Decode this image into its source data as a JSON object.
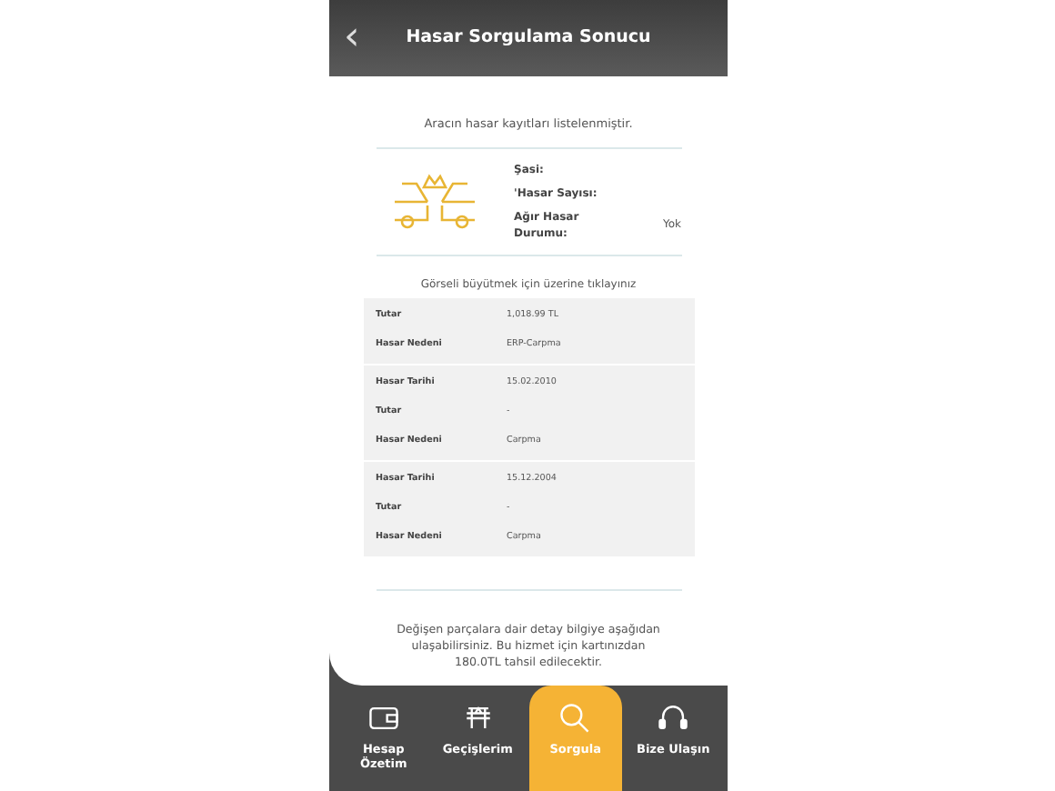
{
  "header": {
    "back": "‹",
    "title": "Hasar Sorgulama Sonucu"
  },
  "intro": "Aracın hasar kayıtları listelenmiştir.",
  "info": [
    {
      "label": "Şasi:"
    },
    {
      "label": "'Hasar Sayısı:"
    },
    {
      "label": "Ağır Hasar Durumu:",
      "value": "Yok"
    }
  ],
  "caption": "Görseli büyütmek için üzerine tıklayınız",
  "groups": [
    [
      {
        "label": "Tutar",
        "value": "1,018.99 TL"
      },
      {
        "label": "Hasar Nedeni",
        "value": "ERP-Carpma"
      }
    ],
    [
      {
        "label": "Hasar Tarihi",
        "value": "15.02.2010"
      },
      {
        "label": "Tutar",
        "value": "-"
      },
      {
        "label": "Hasar Nedeni",
        "value": "Carpma"
      }
    ],
    [
      {
        "label": "Hasar Tarihi",
        "value": "15.12.2004"
      },
      {
        "label": "Tutar",
        "value": "-"
      },
      {
        "label": "Hasar Nedeni",
        "value": "Carpma"
      }
    ]
  ],
  "note": "Değişen parçalara dair detay bilgiye aşağıdan ulaşabilirsiniz. Bu hizmet için kartınızdan 180.0TL tahsil edilecektir.",
  "nav": [
    {
      "label": "Hesap Özetim",
      "selected": false
    },
    {
      "label": "Geçişlerim",
      "selected": false
    },
    {
      "label": "Sorgula",
      "selected": true
    },
    {
      "label": "Bize Ulaşın",
      "selected": false
    }
  ]
}
